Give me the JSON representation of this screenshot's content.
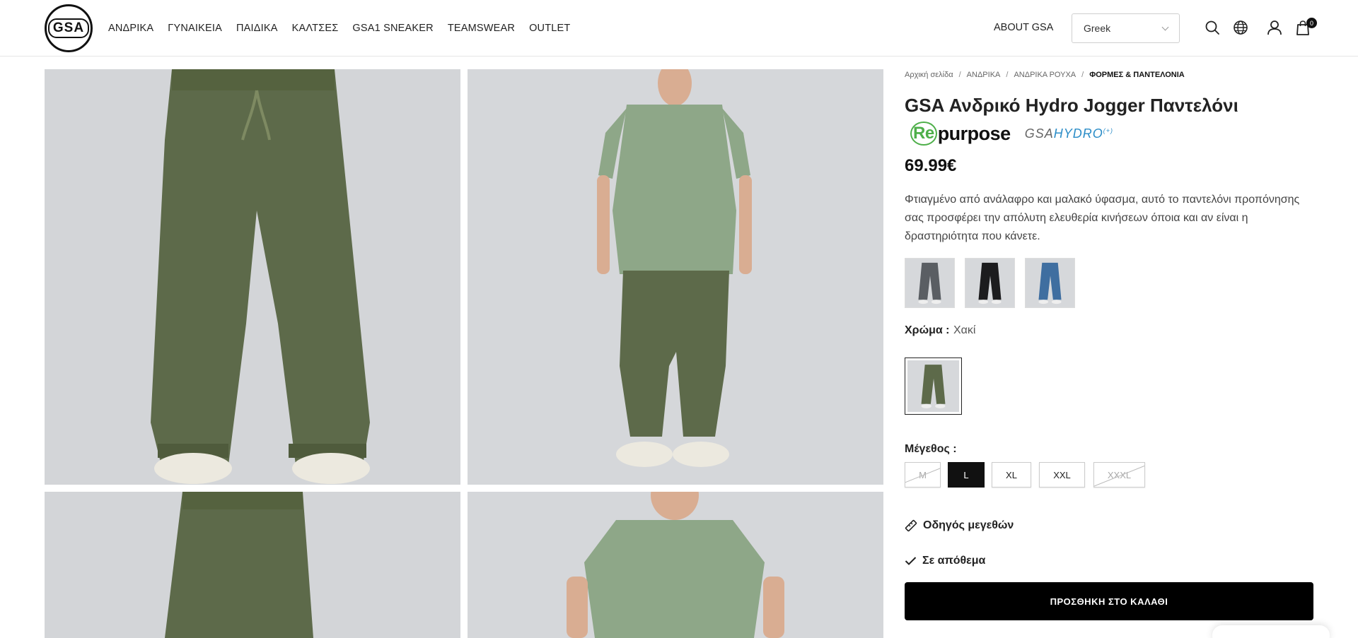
{
  "header": {
    "logo_text": "GSA",
    "nav": [
      "ΑΝΔΡΙΚΑ",
      "ΓΥΝΑΙΚΕΙΑ",
      "ΠΑΙΔΙΚΑ",
      "ΚΑΛΤΣΕΣ",
      "GSA1 SNEAKER",
      "TEAMSWEAR",
      "OUTLET"
    ],
    "about": "ABOUT GSA",
    "language": "Greek",
    "cart_count": "0",
    "icons": [
      "search-icon",
      "globe-icon",
      "user-icon",
      "shopping-bag-icon"
    ]
  },
  "breadcrumb": [
    "Αρχική σελίδα",
    "ΑΝΔΡΙΚΑ",
    "ΑΝΔΡΙΚΑ ΡΟΥΧΑ",
    "ΦΟΡΜΕΣ & ΠΑΝΤΕΛΟΝΙΑ"
  ],
  "product": {
    "title": "GSA Ανδρικό Hydro Jogger Παντελόνι",
    "badge_repurpose_re": "Re",
    "badge_repurpose_rest": "purpose",
    "badge_hydro_gsa": "GSA",
    "badge_hydro_rest": "HYDRO",
    "badge_hydro_mark": "(+)",
    "price": "69.99€",
    "description": "Φτιαγμένο από ανάλαφρο και μαλακό ύφασμα, αυτό το παντελόνι προπόνησης σας προσφέρει την απόλυτη ελευθερία κινήσεων όποια και αν είναι η δραστηριότητα που κάνετε.",
    "variants": [
      {
        "name": "grey",
        "color": "#5a5e63"
      },
      {
        "name": "black",
        "color": "#1c1c1e"
      },
      {
        "name": "blue",
        "color": "#3f6ea0"
      }
    ],
    "color_label": "Χρώμα :",
    "color_value": "Χακί",
    "selected_color": "#5d6a4a",
    "size_label": "Μέγεθος :",
    "sizes": [
      {
        "label": "M",
        "state": "disabled"
      },
      {
        "label": "L",
        "state": "active"
      },
      {
        "label": "XL",
        "state": "available"
      },
      {
        "label": "XXL",
        "state": "available"
      },
      {
        "label": "XXXL",
        "state": "disabled"
      }
    ],
    "size_guide": "Οδηγός μεγεθών",
    "stock": "Σε απόθεμα",
    "add_to_cart": "ΠΡΟΣΘΗΚΗ ΣΤΟ ΚΑΛΑΘΙ"
  },
  "colors": {
    "pants_khaki": "#5d6a4a",
    "shirt_sage": "#8ea788",
    "background_grey": "#d4d6d9",
    "skin": "#d9ad92",
    "shoe": "#eceae3"
  }
}
